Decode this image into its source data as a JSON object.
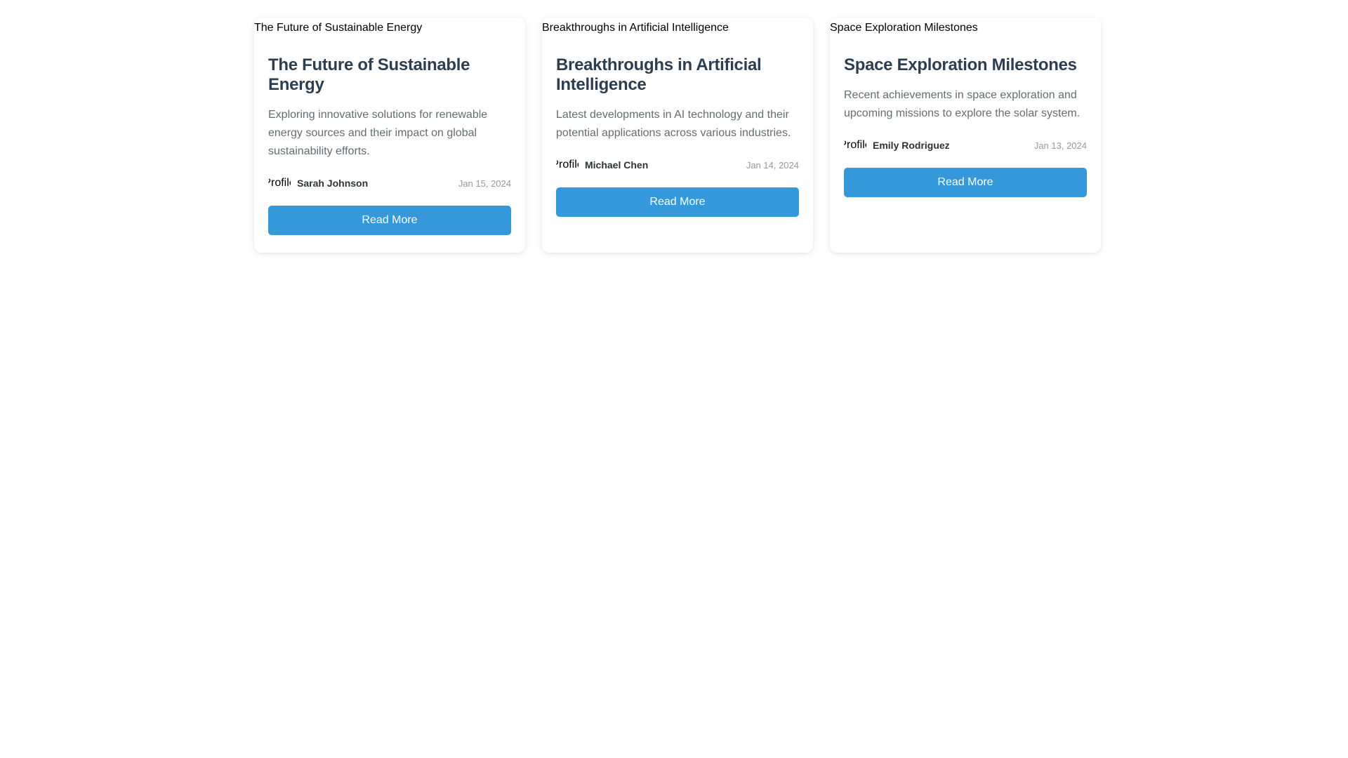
{
  "accent_color": "#3498db",
  "cards": [
    {
      "image_alt": "The Future of Sustainable Energy",
      "title": "The Future of Sustainable Energy",
      "excerpt": "Exploring innovative solutions for renewable energy sources and their impact on global sustainability efforts.",
      "avatar_alt": "Profile",
      "author": "Sarah Johnson",
      "date": "Jan 15, 2024",
      "button_label": "Read More"
    },
    {
      "image_alt": "Breakthroughs in Artificial Intelligence",
      "title": "Breakthroughs in Artificial Intelligence",
      "excerpt": "Latest developments in AI technology and their potential applications across various industries.",
      "avatar_alt": "Profile",
      "author": "Michael Chen",
      "date": "Jan 14, 2024",
      "button_label": "Read More"
    },
    {
      "image_alt": "Space Exploration Milestones",
      "title": "Space Exploration Milestones",
      "excerpt": "Recent achievements in space exploration and upcoming missions to explore the solar system.",
      "avatar_alt": "Profile",
      "author": "Emily Rodriguez",
      "date": "Jan 13, 2024",
      "button_label": "Read More"
    }
  ]
}
